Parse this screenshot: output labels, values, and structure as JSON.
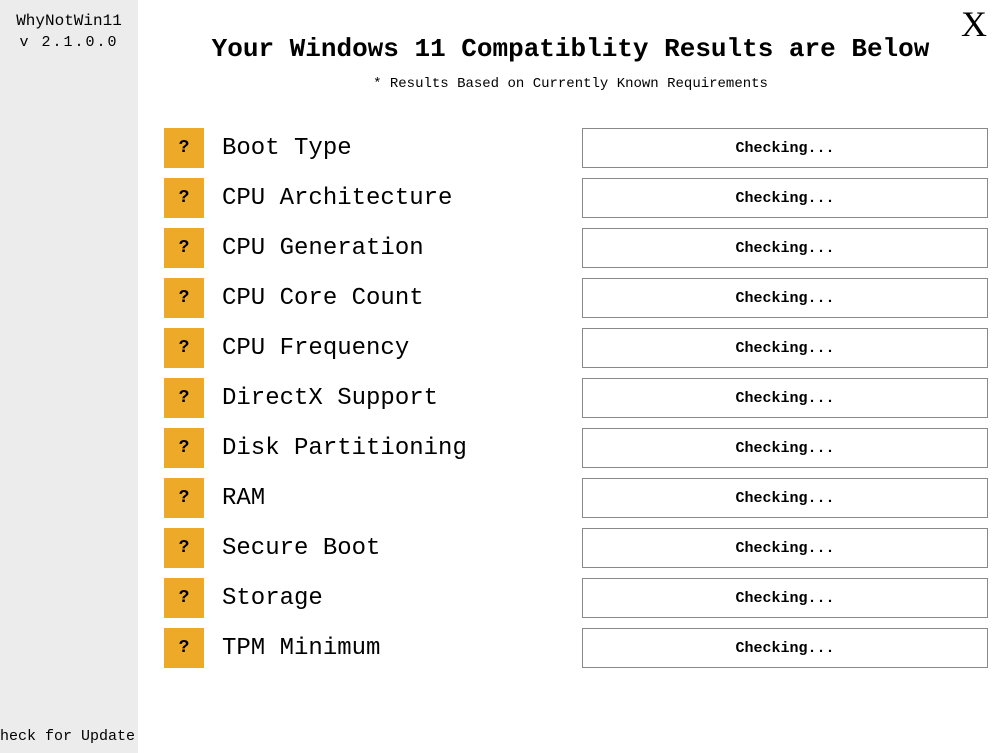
{
  "sidebar": {
    "app_name": "WhyNotWin11",
    "app_version": "v 2.1.0.0",
    "update_text": "heck for Update"
  },
  "header": {
    "title": "Your Windows 11 Compatiblity Results are Below",
    "subtitle": "* Results Based on Currently Known Requirements",
    "close_label": "X"
  },
  "status_checking": "Checking...",
  "status_icon_char": "?",
  "colors": {
    "icon_bg": "#eda928",
    "sidebar_bg": "#ececec",
    "border": "#898989"
  },
  "rows": [
    {
      "label": "Boot Type",
      "status": "Checking..."
    },
    {
      "label": "CPU Architecture",
      "status": "Checking..."
    },
    {
      "label": "CPU Generation",
      "status": "Checking..."
    },
    {
      "label": "CPU Core Count",
      "status": "Checking..."
    },
    {
      "label": "CPU Frequency",
      "status": "Checking..."
    },
    {
      "label": "DirectX Support",
      "status": "Checking..."
    },
    {
      "label": "Disk Partitioning",
      "status": "Checking..."
    },
    {
      "label": "RAM",
      "status": "Checking..."
    },
    {
      "label": "Secure Boot",
      "status": "Checking..."
    },
    {
      "label": "Storage",
      "status": "Checking..."
    },
    {
      "label": "TPM Minimum",
      "status": "Checking..."
    }
  ]
}
